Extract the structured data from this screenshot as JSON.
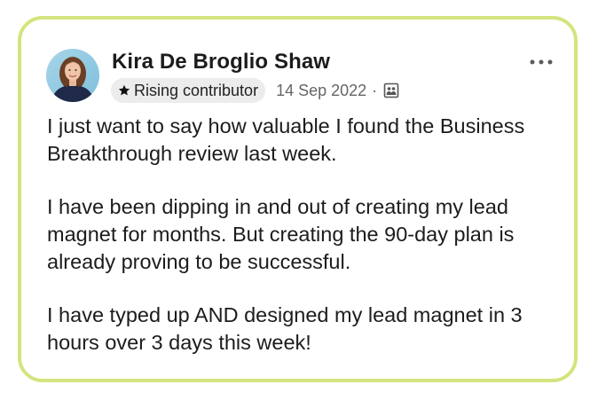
{
  "post": {
    "author": {
      "name": "Kira De Broglio Shaw",
      "badge_label": "Rising contributor",
      "badge_icon": "star-icon",
      "avatar_icon": "avatar"
    },
    "date": "14 Sep 2022",
    "separator": "·",
    "audience_icon": "group-icon",
    "more_icon": "more-horizontal-icon",
    "paragraphs": [
      "I just want to say how valuable I found the Business Breakthrough review last week.",
      "I have been dipping in and out of creating my lead magnet for months. But creating the 90-day plan is already proving to be successful.",
      "I have typed up AND designed my lead magnet in 3 hours over 3 days this week!"
    ]
  },
  "colors": {
    "card_border": "#d2e57e",
    "badge_bg": "#ececec",
    "meta_text": "#666666",
    "body_text": "#1c1c1c"
  }
}
